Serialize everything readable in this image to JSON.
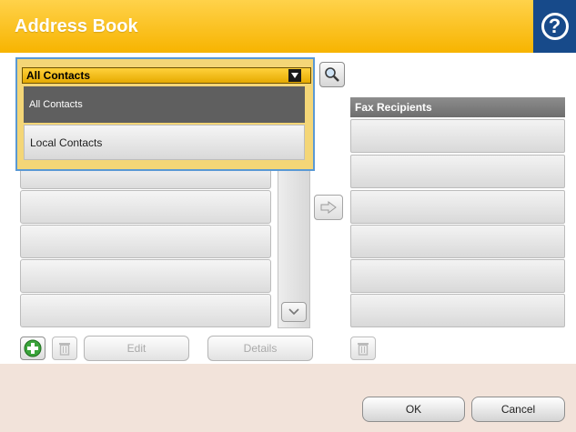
{
  "header": {
    "title": "Address Book",
    "help_icon": "help-icon"
  },
  "dropdown": {
    "selected": "All Contacts",
    "options": [
      "All Contacts",
      "Local Contacts"
    ]
  },
  "recipients": {
    "header": "Fax Recipients"
  },
  "actions": {
    "edit_label": "Edit",
    "details_label": "Details",
    "add_icon": "add-icon",
    "delete_icon": "trash-icon"
  },
  "footer": {
    "ok_label": "OK",
    "cancel_label": "Cancel"
  },
  "colors": {
    "header_yellow": "#f7b400",
    "help_blue": "#174a8a",
    "selection_blue": "#5a99d4",
    "add_green": "#3aa33a"
  }
}
